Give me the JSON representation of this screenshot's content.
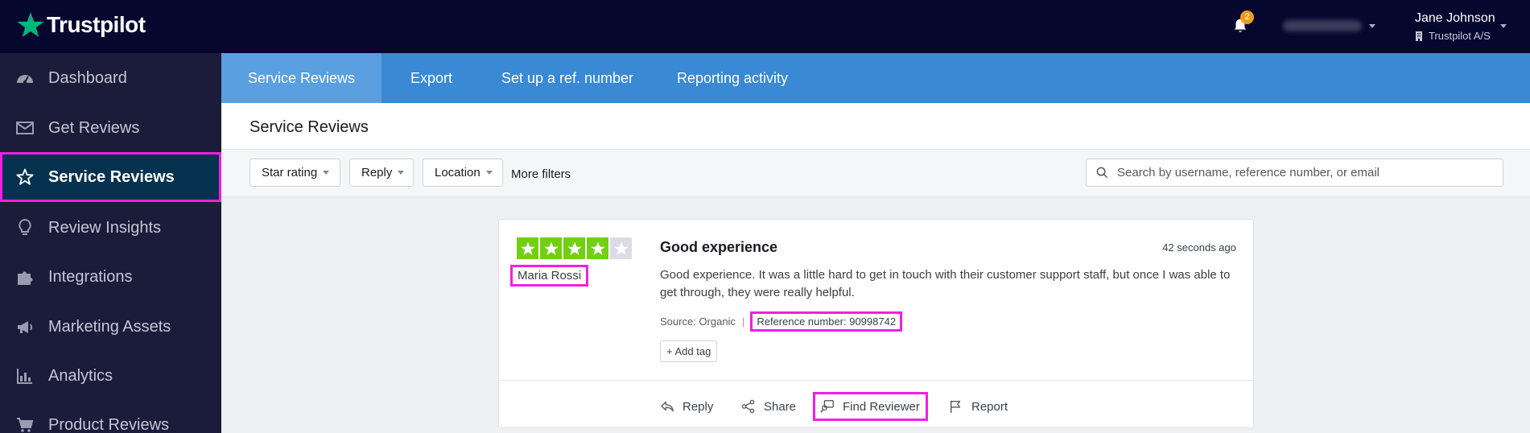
{
  "brand": {
    "name": "Trustpilot",
    "star_color": "#00b67a"
  },
  "topbar": {
    "notification_count": "2",
    "user_name": "Jane Johnson",
    "user_company": "Trustpilot A/S"
  },
  "sidebar": {
    "items": [
      {
        "label": "Dashboard",
        "icon": "dashboard-icon"
      },
      {
        "label": "Get Reviews",
        "icon": "envelope-icon"
      },
      {
        "label": "Service Reviews",
        "icon": "star-outline-icon",
        "active": true
      },
      {
        "label": "Review Insights",
        "icon": "lightbulb-icon"
      },
      {
        "label": "Integrations",
        "icon": "puzzle-icon"
      },
      {
        "label": "Marketing Assets",
        "icon": "megaphone-icon"
      },
      {
        "label": "Analytics",
        "icon": "bar-chart-icon"
      },
      {
        "label": "Product Reviews",
        "icon": "cart-icon"
      }
    ]
  },
  "tabs": [
    {
      "label": "Service Reviews",
      "active": true
    },
    {
      "label": "Export"
    },
    {
      "label": "Set up a ref. number"
    },
    {
      "label": "Reporting activity"
    }
  ],
  "page": {
    "title": "Service Reviews"
  },
  "filters": {
    "star_rating": "Star rating",
    "reply": "Reply",
    "location": "Location",
    "more": "More filters",
    "search_placeholder": "Search by username, reference number, or email"
  },
  "review": {
    "rating": 4,
    "max_rating": 5,
    "star_fill_color": "#73cf11",
    "star_empty_color": "#dcdce6",
    "reviewer": "Maria Rossi",
    "title": "Good experience",
    "time": "42 seconds ago",
    "body": "Good experience. It was a little hard to get in touch with their customer support staff, but once I was able to get through, they were really helpful.",
    "source": "Source: Organic",
    "separator": "|",
    "reference": "Reference number:  90998742",
    "add_tag": "+ Add tag",
    "actions": {
      "reply": "Reply",
      "share": "Share",
      "find_reviewer": "Find Reviewer",
      "report": "Report"
    }
  },
  "highlight_color": "#f21ee5"
}
